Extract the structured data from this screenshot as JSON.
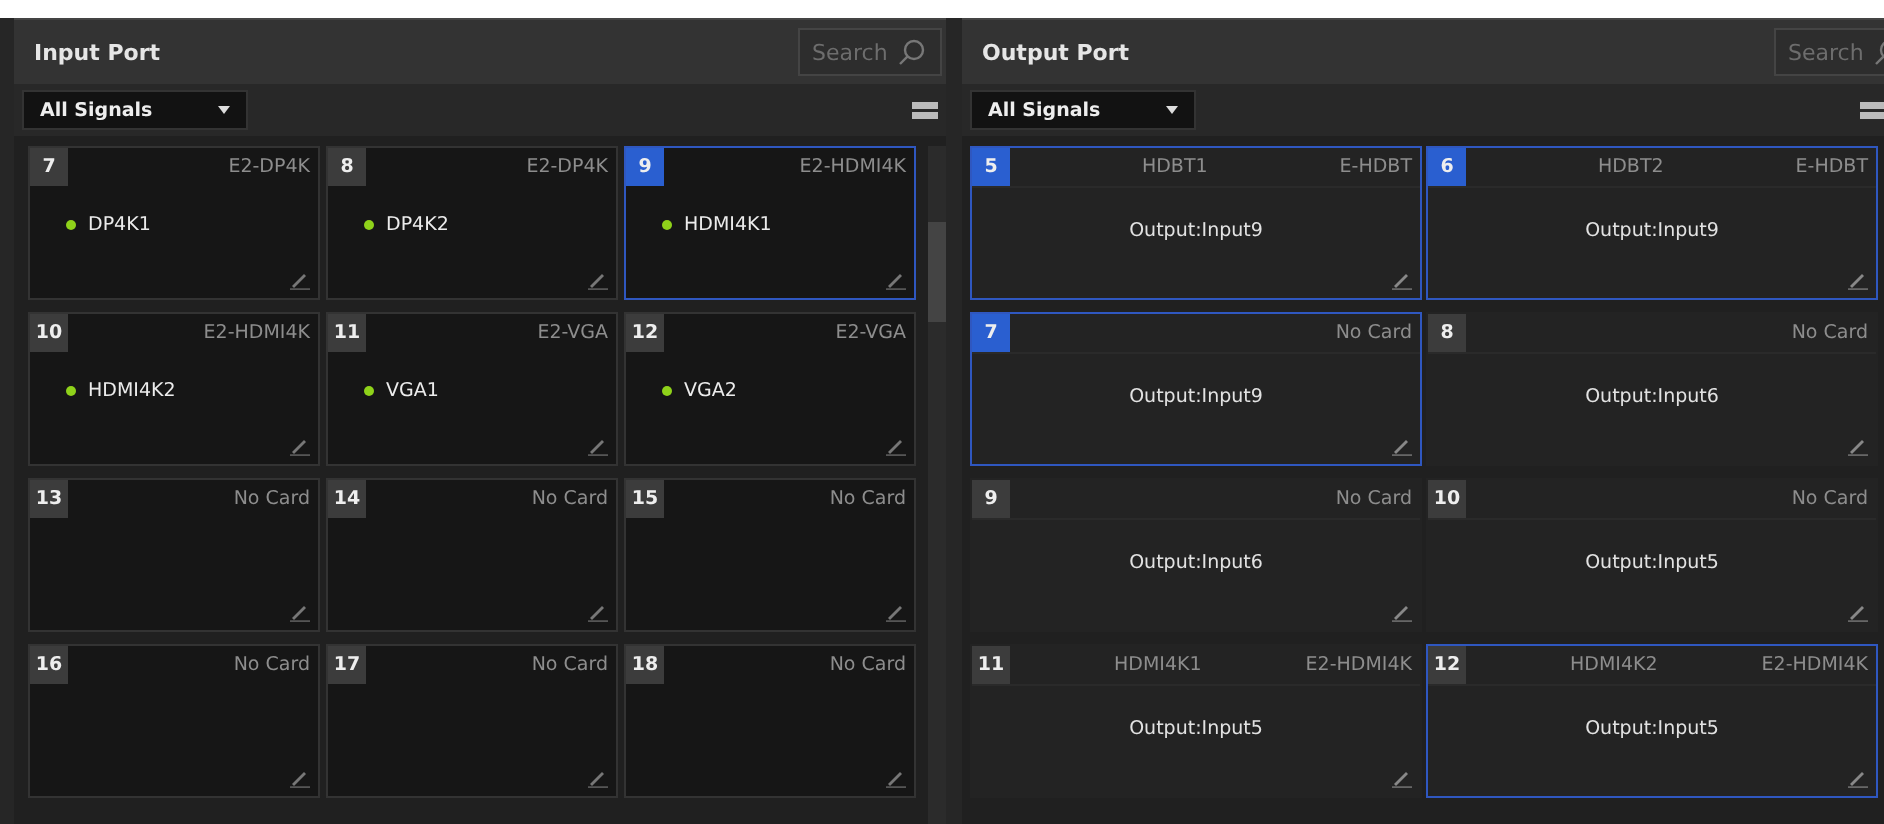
{
  "input_port": {
    "title": "Input Port",
    "search": {
      "placeholder": "Search"
    },
    "filter": "All Signals",
    "cards": [
      {
        "number": "7",
        "card": "E2-DP4K",
        "signal": "DP4K1",
        "has_signal": true,
        "selected": false
      },
      {
        "number": "8",
        "card": "E2-DP4K",
        "signal": "DP4K2",
        "has_signal": true,
        "selected": false
      },
      {
        "number": "9",
        "card": "E2-HDMI4K",
        "signal": "HDMI4K1",
        "has_signal": true,
        "selected": true
      },
      {
        "number": "10",
        "card": "E2-HDMI4K",
        "signal": "HDMI4K2",
        "has_signal": true,
        "selected": false
      },
      {
        "number": "11",
        "card": "E2-VGA",
        "signal": "VGA1",
        "has_signal": true,
        "selected": false
      },
      {
        "number": "12",
        "card": "E2-VGA",
        "signal": "VGA2",
        "has_signal": true,
        "selected": false
      },
      {
        "number": "13",
        "card": "No Card",
        "has_signal": false,
        "selected": false
      },
      {
        "number": "14",
        "card": "No Card",
        "has_signal": false,
        "selected": false
      },
      {
        "number": "15",
        "card": "No Card",
        "has_signal": false,
        "selected": false
      },
      {
        "number": "16",
        "card": "No Card",
        "has_signal": false,
        "selected": false
      },
      {
        "number": "17",
        "card": "No Card",
        "has_signal": false,
        "selected": false
      },
      {
        "number": "18",
        "card": "No Card",
        "has_signal": false,
        "selected": false
      }
    ]
  },
  "output_port": {
    "title": "Output Port",
    "search": {
      "placeholder": "Search"
    },
    "filter": "All Signals",
    "cards": [
      {
        "number": "5",
        "port": "HDBT1",
        "card": "E-HDBT",
        "source": "Output:Input9",
        "selected": true,
        "outlined": true
      },
      {
        "number": "6",
        "port": "HDBT2",
        "card": "E-HDBT",
        "source": "Output:Input9",
        "selected": true,
        "outlined": true
      },
      {
        "number": "7",
        "card": "No Card",
        "source": "Output:Input9",
        "selected": true,
        "outlined": true
      },
      {
        "number": "8",
        "card": "No Card",
        "source": "Output:Input6",
        "selected": false,
        "outlined": false
      },
      {
        "number": "9",
        "card": "No Card",
        "source": "Output:Input6",
        "selected": false,
        "outlined": false
      },
      {
        "number": "10",
        "card": "No Card",
        "source": "Output:Input5",
        "selected": false,
        "outlined": false
      },
      {
        "number": "11",
        "port": "HDMI4K1",
        "card": "E2-HDMI4K",
        "source": "Output:Input5",
        "selected": false,
        "outlined": false
      },
      {
        "number": "12",
        "port": "HDMI4K2",
        "card": "E2-HDMI4K",
        "source": "Output:Input5",
        "selected": false,
        "outlined": true
      }
    ]
  }
}
